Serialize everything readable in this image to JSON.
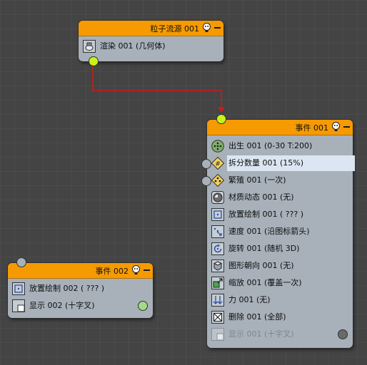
{
  "nodes": {
    "source": {
      "title": "粒子流源 001",
      "operators": [
        {
          "label": "渲染 001 (几何体)",
          "icon": "render-teapot-icon"
        }
      ]
    },
    "event1": {
      "title": "事件 001",
      "operators": [
        {
          "label": "出生 001 (0-30 T:200)",
          "icon": "birth-icon"
        },
        {
          "label": "拆分数量 001 (15%)",
          "icon": "split-amount-icon"
        },
        {
          "label": "繁殖 001 (一次)",
          "icon": "spawn-icon"
        },
        {
          "label": "材质动态 001 (无)",
          "icon": "material-dynamic-icon"
        },
        {
          "label": "放置绘制 001 ( ??? )",
          "icon": "placement-paint-icon"
        },
        {
          "label": "速度 001 (沿图标箭头)",
          "icon": "speed-icon"
        },
        {
          "label": "旋转 001 (随机 3D)",
          "icon": "rotation-icon"
        },
        {
          "label": "图形朝向 001 (无)",
          "icon": "shape-facing-icon"
        },
        {
          "label": "缩放 001 (覆盖一次)",
          "icon": "scale-icon"
        },
        {
          "label": "力 001 (无)",
          "icon": "force-icon"
        },
        {
          "label": "删除 001 (全部)",
          "icon": "delete-icon"
        },
        {
          "label": "显示 001 (十字叉)",
          "icon": "display-icon"
        }
      ]
    },
    "event2": {
      "title": "事件 002",
      "operators": [
        {
          "label": "放置绘制 002 ( ??? )",
          "icon": "placement-paint-icon"
        },
        {
          "label": "显示 002 (十字叉)",
          "icon": "display-icon"
        }
      ]
    }
  },
  "colors": {
    "header": "#f59a00",
    "node_body": "#a8b1ba",
    "wire": "#cc1a1a",
    "output_port": "#c9f21a",
    "connected_port": "#a2d98a"
  }
}
